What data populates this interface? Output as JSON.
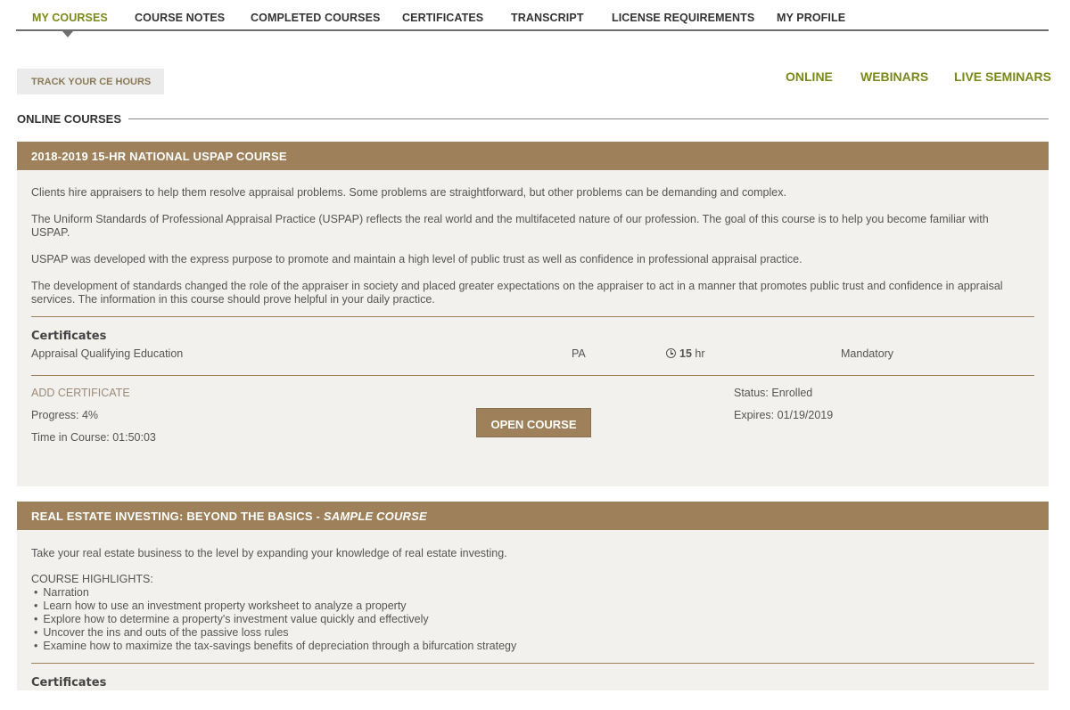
{
  "nav": {
    "items": [
      "MY COURSES",
      "COURSE NOTES",
      "COMPLETED COURSES",
      "CERTIFICATES",
      "TRANSCRIPT",
      "LICENSE REQUIREMENTS",
      "MY PROFILE"
    ],
    "active": "MY COURSES"
  },
  "track_button": "TRACK YOUR CE HOURS",
  "filters": [
    "ONLINE",
    "WEBINARS",
    "LIVE SEMINARS"
  ],
  "section_title": "ONLINE COURSES",
  "course1": {
    "title": "2018-2019 15-HR NATIONAL USPAP COURSE",
    "paragraphs": [
      "Clients hire appraisers to help them resolve appraisal problems. Some problems are straightforward, but other problems can be demanding and complex.",
      "The Uniform Standards of Professional Appraisal Practice (USPAP) reflects the real world and the multifaceted nature of our profession. The goal of this course is to help you become familiar with USPAP.",
      "USPAP was developed with the express purpose to promote and maintain a high level of public trust as well as confidence in professional appraisal practice.",
      "The development of standards changed the role of the appraiser in society and placed greater expectations on the appraiser to act in a manner that promotes public trust and confidence in appraisal services. The information in this course should prove helpful in your daily practice."
    ],
    "certificates_label": "Certificates",
    "certificate": {
      "name": "Appraisal Qualifying Education",
      "state": "PA",
      "hours": "15",
      "hours_unit": "hr",
      "type": "Mandatory"
    },
    "add_certificate": "ADD CERTIFICATE",
    "progress": "Progress: 4%",
    "time_in_course": "Time in Course: 01:50:03",
    "open_button": "OPEN COURSE",
    "status": "Status: Enrolled",
    "expires": "Expires: 01/19/2019"
  },
  "course2": {
    "title_main": "REAL ESTATE INVESTING: BEYOND THE BASICS - ",
    "title_italic": "SAMPLE COURSE",
    "intro": "Take your real estate business to the level by expanding your knowledge of real estate investing.",
    "highlights_label": "COURSE HIGHLIGHTS:",
    "highlights": [
      "Narration",
      "Learn how to use an investment property worksheet to analyze a property",
      "Explore how to determine a property's investment value quickly and effectively",
      "Uncover the ins and outs of the passive loss rules",
      "Examine how to maximize the tax-savings benefits of depreciation through a bifurcation strategy"
    ],
    "certificates_label": "Certificates"
  },
  "colors": {
    "accent_green": "#7a8a1a",
    "header_brown": "#9e805a",
    "card_bg": "#f3f1ee"
  },
  "icons": {
    "hours": "clock-icon",
    "nav_indicator": "caret-down-icon"
  }
}
